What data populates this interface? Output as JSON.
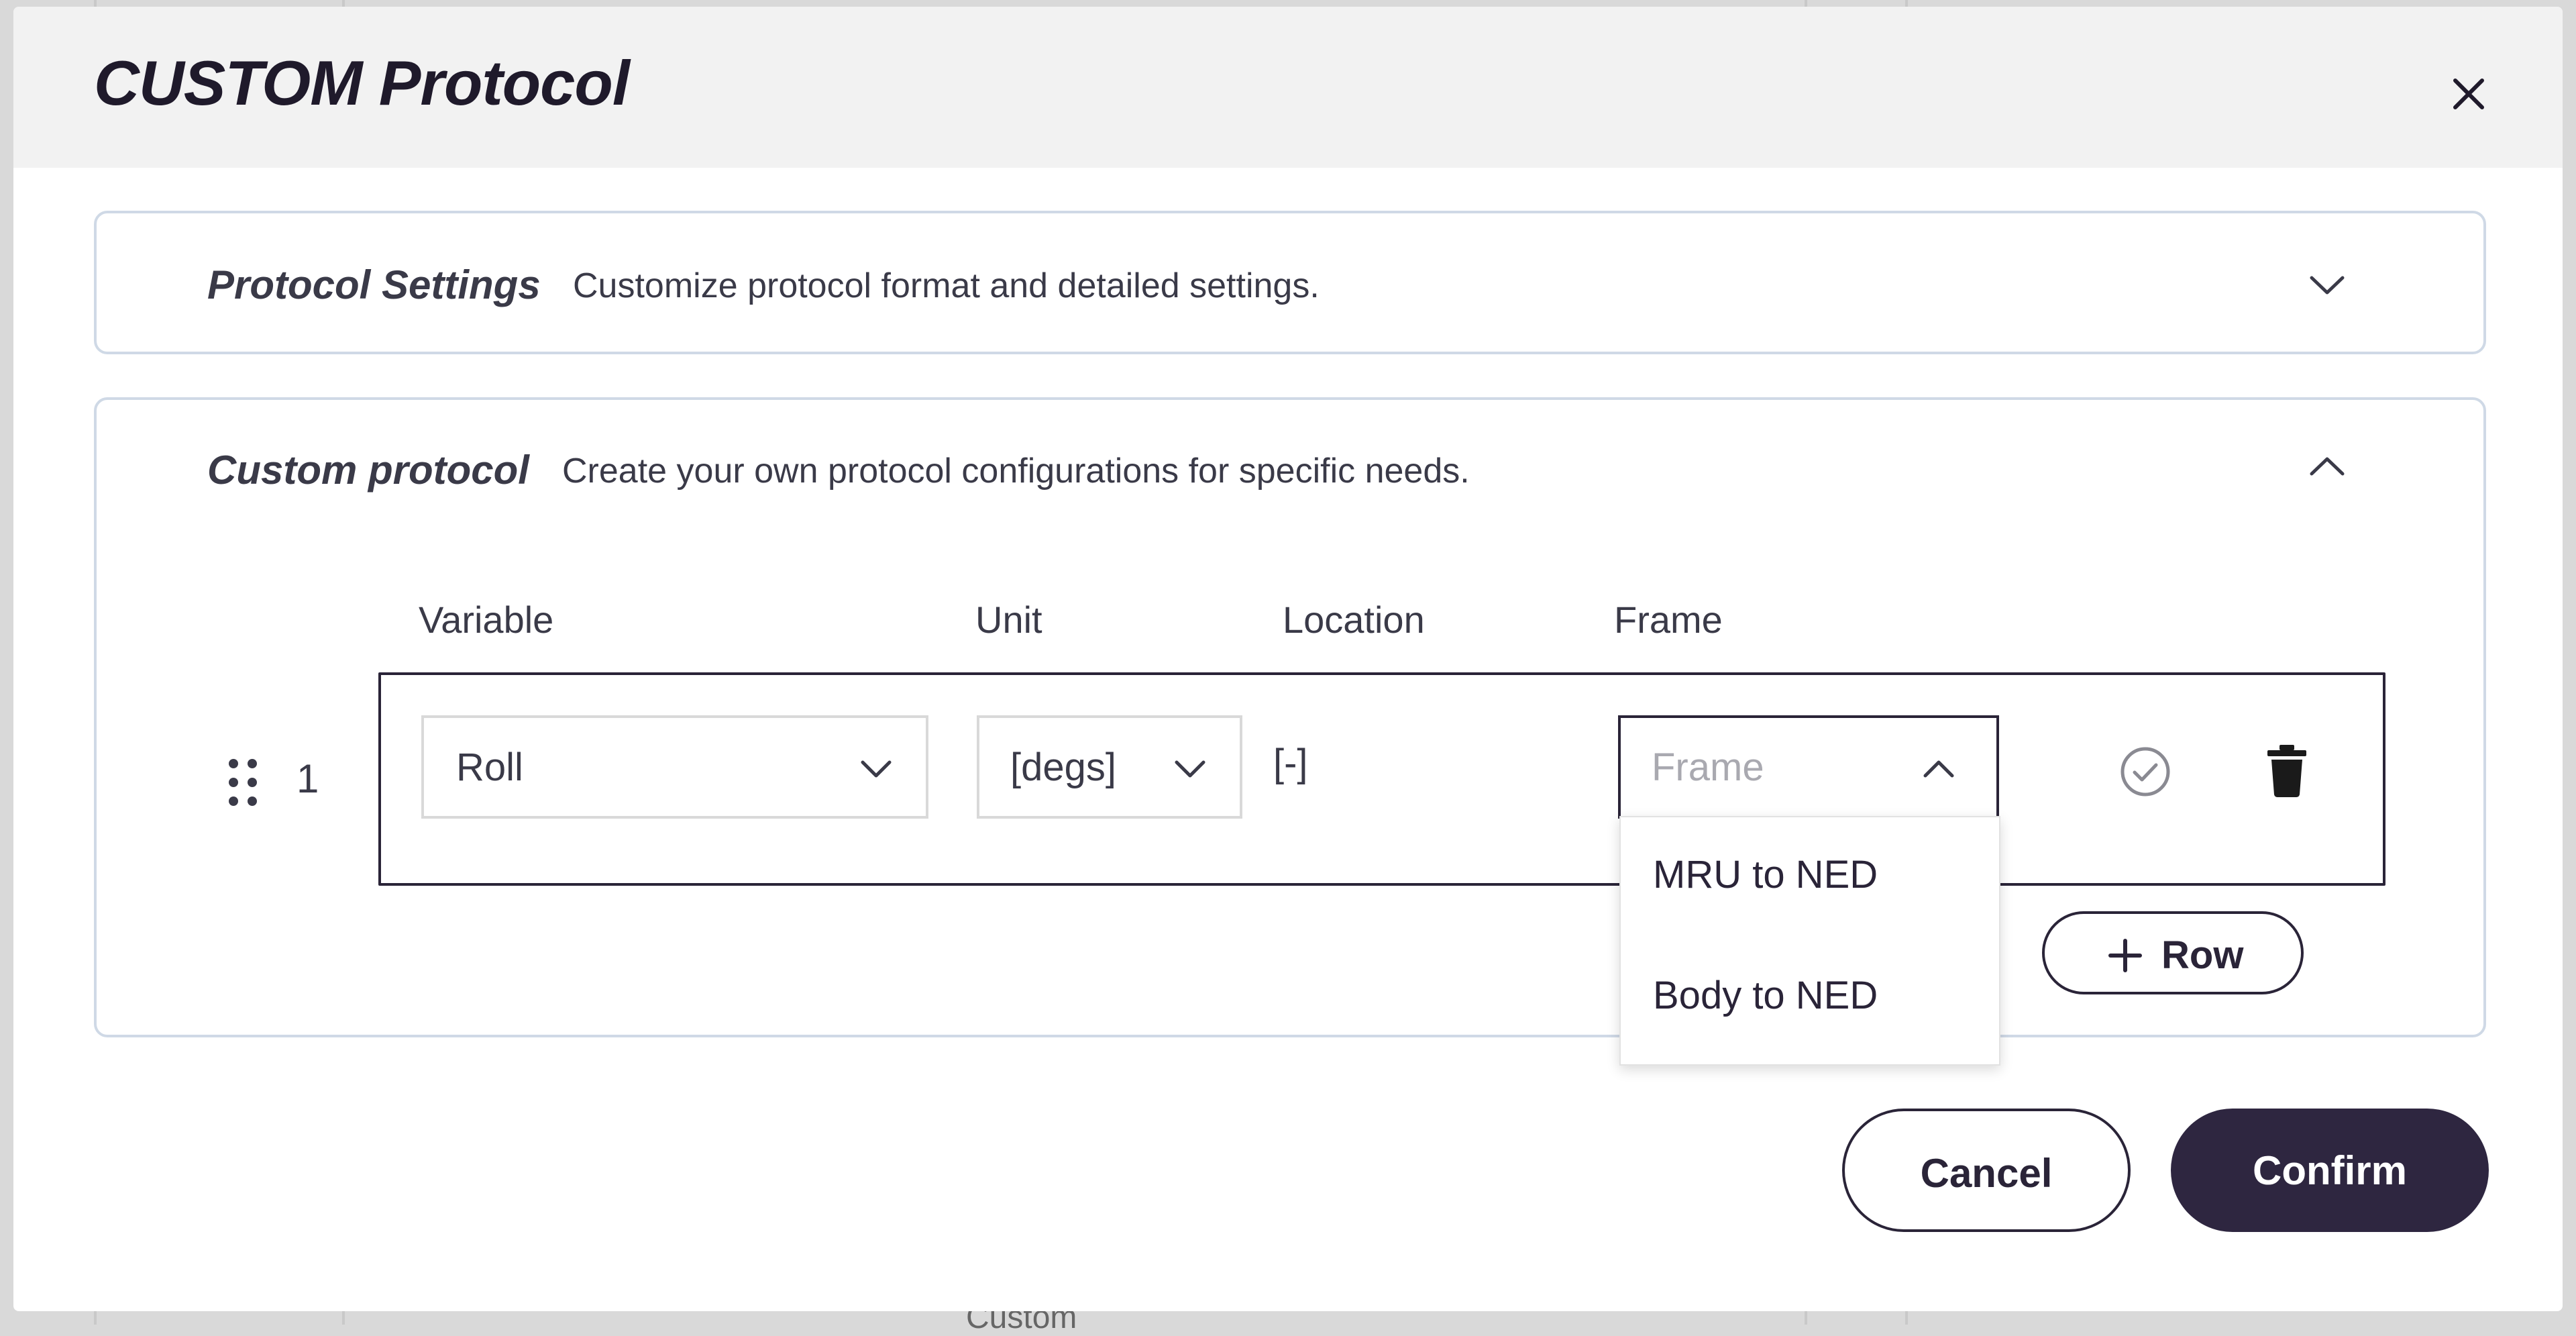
{
  "modal": {
    "title": "CUSTOM Protocol"
  },
  "sections": {
    "protocol_settings": {
      "title": "Protocol Settings",
      "description": "Customize protocol format and detailed settings.",
      "expanded": false
    },
    "custom_protocol": {
      "title": "Custom protocol",
      "description": "Create your own protocol configurations for specific needs.",
      "expanded": true
    }
  },
  "table": {
    "columns": {
      "variable": "Variable",
      "unit": "Unit",
      "location": "Location",
      "frame": "Frame"
    },
    "rows": [
      {
        "index": "1",
        "variable": "Roll",
        "unit": "[degs]",
        "location": "[-]",
        "frame_placeholder": "Frame"
      }
    ]
  },
  "frame_dropdown": {
    "open": true,
    "options": [
      "MRU to NED",
      "Body to NED"
    ]
  },
  "add_row": {
    "label": "Row"
  },
  "footer": {
    "cancel_label": "Cancel",
    "confirm_label": "Confirm"
  },
  "background": {
    "bottom_select_value": "Custom"
  },
  "colors": {
    "primary": "#2e2640",
    "panel_border": "#cfd9e6",
    "header_bg": "#f2f2f2"
  }
}
